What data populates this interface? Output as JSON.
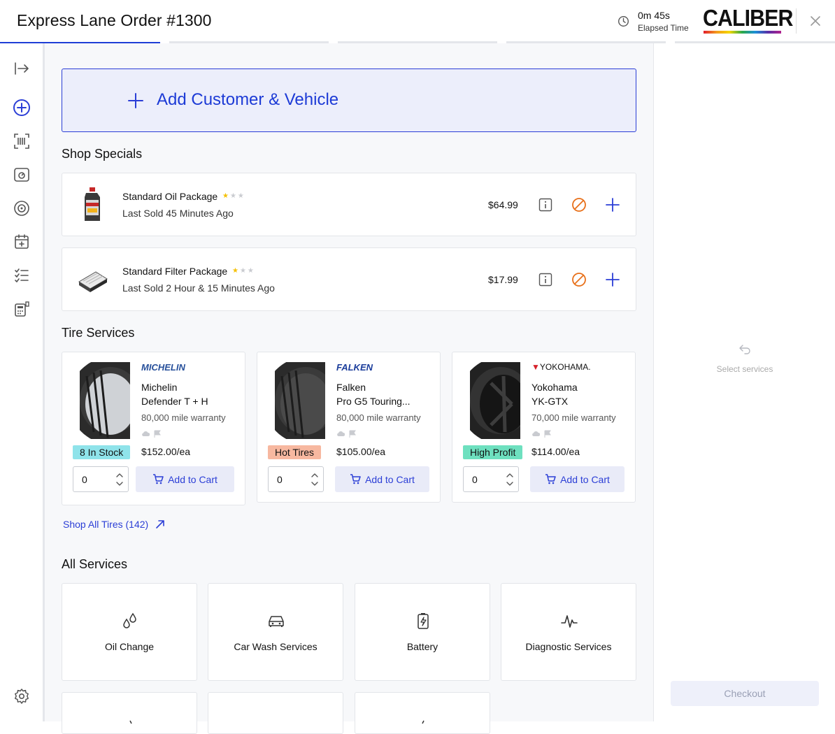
{
  "header": {
    "title": "Express Lane Order #1300",
    "elapsed_value": "0m 45s",
    "elapsed_label": "Elapsed Time",
    "brand": "CALIBER"
  },
  "main": {
    "add_customer_label": "Add Customer & Vehicle",
    "shop_specials_title": "Shop Specials",
    "specials": [
      {
        "name": "Standard Oil Package",
        "rating": 1,
        "rating_max": 3,
        "last_sold": "Last Sold 45 Minutes Ago",
        "price": "$64.99"
      },
      {
        "name": "Standard Filter Package",
        "rating": 1,
        "rating_max": 3,
        "last_sold": "Last Sold 2 Hour & 15 Minutes Ago",
        "price": "$17.99"
      }
    ],
    "tire_services_title": "Tire Services",
    "tires": [
      {
        "logo": "MICHELIN",
        "brand": "Michelin",
        "model": "Defender T + H",
        "warranty": "80,000 mile warranty",
        "badge": "8 In Stock",
        "badge_color": "#8fe3ea",
        "price": "$152.00/ea",
        "qty": "0",
        "add_label": "Add to Cart"
      },
      {
        "logo": "FALKEN",
        "brand": "Falken",
        "model": "Pro G5 Touring...",
        "warranty": "80,000 mile warranty",
        "badge": "Hot Tires",
        "badge_color": "#f7b8a0",
        "price": "$105.00/ea",
        "qty": "0",
        "add_label": "Add to Cart"
      },
      {
        "logo": "YOKOHAMA.",
        "brand": "Yokohama",
        "model": "YK-GTX",
        "warranty": "70,000 mile warranty",
        "badge": "High Profit",
        "badge_color": "#6ee0bf",
        "price": "$114.00/ea",
        "qty": "0",
        "add_label": "Add to Cart"
      }
    ],
    "shop_all_label": "Shop All Tires (142)",
    "all_services_title": "All Services",
    "services": [
      {
        "label": "Oil Change",
        "icon": "oil-drops-icon"
      },
      {
        "label": "Car Wash Services",
        "icon": "car-icon"
      },
      {
        "label": "Battery",
        "icon": "battery-icon"
      },
      {
        "label": "Diagnostic Services",
        "icon": "pulse-icon"
      }
    ]
  },
  "right_panel": {
    "empty_text": "Select services",
    "checkout_label": "Checkout"
  },
  "colors": {
    "accent": "#2b3ed6",
    "warning": "#e8701a"
  }
}
